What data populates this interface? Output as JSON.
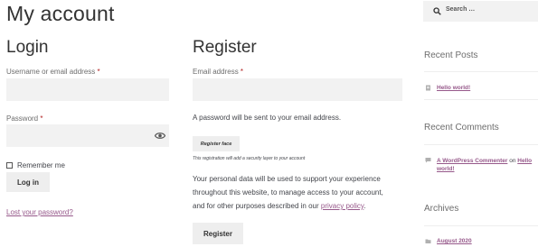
{
  "page": {
    "title": "My account"
  },
  "login": {
    "title": "Login",
    "username_label": "Username or email address",
    "username_value": "",
    "password_label": "Password",
    "password_value": "",
    "required_mark": "*",
    "remember_label": "Remember me",
    "login_button": "Log in",
    "lost_password_link": "Lost your password?"
  },
  "register": {
    "title": "Register",
    "email_label": "Email address",
    "email_value": "",
    "required_mark": "*",
    "password_notice": "A password will be sent to your email address.",
    "register_face_button": "Register face",
    "security_note": "This registration will add a security layer to your account",
    "privacy_line1": "Your personal data will be used to support your experience",
    "privacy_line2": "throughout this website, to manage access to your account,",
    "privacy_line3_prefix": "and for other purposes described in our ",
    "privacy_link": "privacy policy",
    "privacy_line3_suffix": ".",
    "register_button": "Register"
  },
  "sidebar": {
    "search_placeholder": "Search …",
    "recent_posts_title": "Recent Posts",
    "recent_posts": [
      {
        "label": "Hello world!"
      }
    ],
    "recent_comments_title": "Recent Comments",
    "recent_comments": [
      {
        "author": "A WordPress Commenter",
        "on": "on",
        "post_part1": "Hello",
        "post_part2": "world!"
      }
    ],
    "archives_title": "Archives",
    "archives": [
      {
        "label": "August 2020"
      }
    ]
  },
  "icons": {
    "eye": "eye-icon",
    "search": "search-icon",
    "post": "document-icon",
    "comment": "comment-icon",
    "archive": "folder-icon"
  },
  "colors": {
    "link": "#96588a",
    "required": "#b22222",
    "field_bg": "#f2f2f2",
    "button_bg": "#eeeeee"
  }
}
